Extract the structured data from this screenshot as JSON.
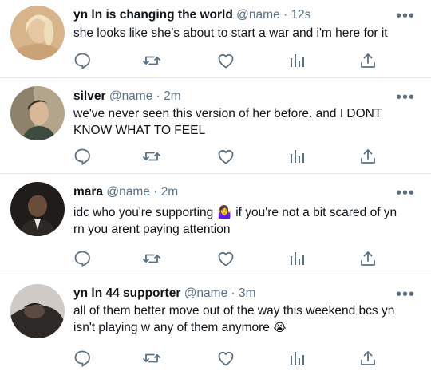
{
  "tweets": [
    {
      "name": "yn ln is changing the world",
      "handle": "@name",
      "separator": "·",
      "time": "12s",
      "text": "she looks like she's about to start a war and i'm here for it",
      "text2": "",
      "emoji": "",
      "avatar_colors": [
        "#c9a57a",
        "#e8c9a8"
      ]
    },
    {
      "name": "silver",
      "handle": "@name",
      "separator": "·",
      "time": "2m",
      "text": "we've never seen this version of her before. and I DONT",
      "text2": "KNOW WHAT TO FEEL",
      "emoji": "",
      "avatar_colors": [
        "#9c8e78",
        "#d9c7a8"
      ]
    },
    {
      "name": "mara",
      "handle": "@name",
      "separator": "·",
      "time": "2m",
      "text": "idc who you're supporting 🤷‍♀️ if you're not a bit scared of yn",
      "text2": "rn you arent paying attention",
      "emoji": "",
      "avatar_colors": [
        "#2a2623",
        "#6b5c50"
      ]
    },
    {
      "name": "yn ln 44 supporter",
      "handle": "@name",
      "separator": "·",
      "time": "3m",
      "text": "all of them better move out of the way this weekend bcs yn",
      "text2": "isn't playing w any of them anymore",
      "emoji": "😭",
      "avatar_colors": [
        "#3b3734",
        "#d8d4d0"
      ]
    }
  ],
  "icons": {
    "reply": "reply-icon",
    "retweet": "retweet-icon",
    "like": "like-icon",
    "analytics": "analytics-icon",
    "share": "share-icon",
    "more": "more-icon"
  },
  "colors": {
    "icon": "#5b7083",
    "divider": "#e1e6ea"
  },
  "more_glyph": "•••"
}
